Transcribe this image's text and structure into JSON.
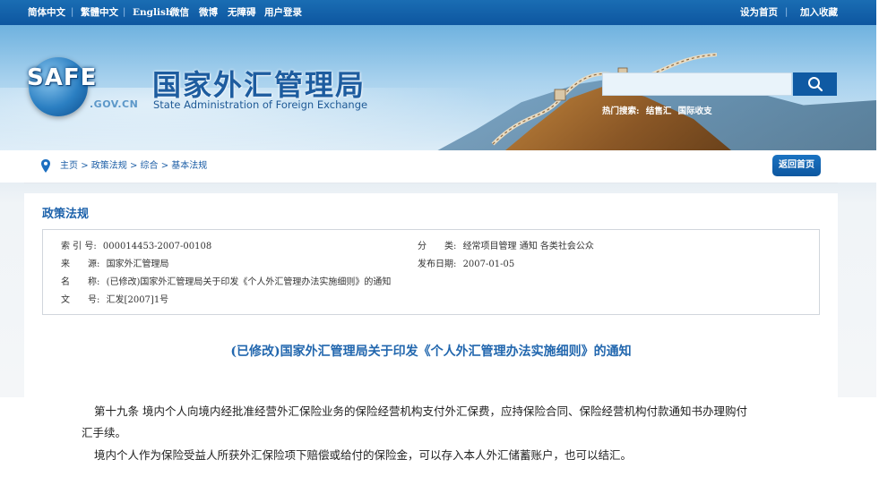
{
  "topbar": {
    "links": [
      "简体中文",
      "繁體中文",
      "English",
      "微信",
      "微博",
      "无障碍",
      "用户登录"
    ],
    "right": [
      "设为首页",
      "加入收藏"
    ]
  },
  "brand": {
    "logo": "SAFE",
    "domain": ".GOV.CN",
    "title_cn": "国家外汇管理局",
    "title_en": "State Administration of Foreign Exchange"
  },
  "search": {
    "placeholder": "",
    "hot_label": "热门搜索:",
    "hot_terms": [
      "结售汇",
      "国际收支"
    ],
    "icon": "search-icon"
  },
  "breadcrumb": {
    "items": [
      "主页",
      "政策法规",
      "综合",
      "基本法规"
    ],
    "separator": ">",
    "home_button": "返回首页"
  },
  "section": {
    "title": "政策法规"
  },
  "meta": {
    "index_label": "索 引 号:",
    "index_value": "000014453-2007-00108",
    "category_label": "分　　类:",
    "category_value": "经常项目管理 通知 各类社会公众",
    "source_label": "来　　源:",
    "source_value": "国家外汇管理局",
    "date_label": "发布日期:",
    "date_value": "2007-01-05",
    "name_label": "名　　称:",
    "name_value": "(已修改)国家外汇管理局关于印发《个人外汇管理办法实施细则》的通知",
    "docno_label": "文　　号:",
    "docno_value": "汇发[2007]1号"
  },
  "document": {
    "title": "(已修改)国家外汇管理局关于印发《个人外汇管理办法实施细则》的通知",
    "paragraphs": [
      "第十九条 境内个人向境内经批准经营外汇保险业务的保险经营机构支付外汇保费，应持保险合同、保险经营机构付款通知书办理购付",
      "汇手续。",
      "境内个人作为保险受益人所获外汇保险项下赔偿或给付的保险金，可以存入本人外汇储蓄账户，也可以结汇。"
    ]
  },
  "colors": {
    "topbar": "#0d56a0",
    "accent": "#1d62ab",
    "button": "#0d57a0"
  }
}
